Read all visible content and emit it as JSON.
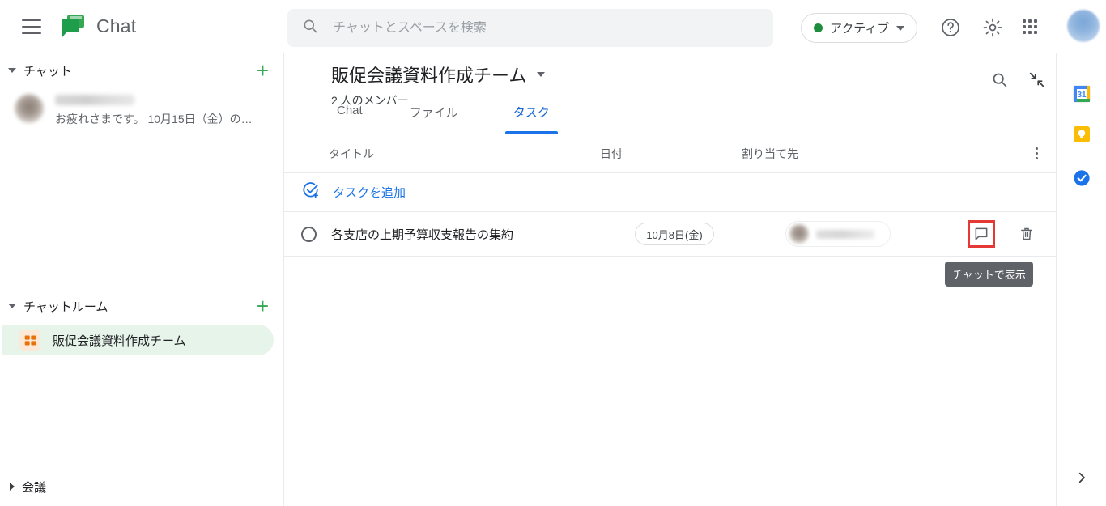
{
  "topbar": {
    "menu_icon": "hamburger-icon",
    "app_name": "Chat",
    "app_logo_icon": "google-chat-logo",
    "search": {
      "placeholder": "チャットとスペースを検索",
      "value": "",
      "icon": "search-icon"
    },
    "status": {
      "label": "アクティブ",
      "dot_color": "#1e8e3e",
      "caret_icon": "chevron-down-icon"
    },
    "help_icon": "help-circle-icon",
    "settings_icon": "gear-icon",
    "apps_icon": "apps-grid-icon",
    "account_avatar": "avatar"
  },
  "sidebar": {
    "chat_section": {
      "title": "チャット",
      "expand_icon": "triangle-down-icon",
      "add_icon": "plus-icon",
      "items": [
        {
          "name_redacted": true,
          "preview": "お疲れさまです。 10月15日（金）の…",
          "avatar": "avatar"
        }
      ]
    },
    "rooms_section": {
      "title": "チャットルーム",
      "expand_icon": "triangle-down-icon",
      "add_icon": "plus-icon",
      "items": [
        {
          "label": "販促会議資料作成チーム",
          "icon": "room-people-icon",
          "selected": true,
          "icon_bg": "#fce8d6",
          "selected_bg": "#e6f4ea"
        }
      ]
    },
    "meetings_section": {
      "title": "会議",
      "expand_icon": "triangle-right-icon"
    }
  },
  "main": {
    "room_title": "販促会議資料作成チーム",
    "room_title_caret": "chevron-down-icon",
    "member_count": "2 人のメンバー",
    "header_search_icon": "search-icon",
    "header_collapse_icon": "collapse-arrows-icon",
    "tabs": [
      {
        "label": "Chat",
        "active": false
      },
      {
        "label": "ファイル",
        "active": false
      },
      {
        "label": "タスク",
        "active": true
      }
    ],
    "active_tab_color": "#1a73e8",
    "columns": {
      "title": "タイトル",
      "date": "日付",
      "assignee": "割り当て先",
      "overflow_icon": "more-vertical-icon"
    },
    "add_task": {
      "label": "タスクを追加",
      "icon": "add-task-icon",
      "color": "#1a73e8"
    },
    "tasks": [
      {
        "checkbox_icon": "circle-checkbox-icon",
        "title": "各支店の上期予算収支報告の集約",
        "date": "10月8日(金)",
        "assignee_redacted": true,
        "chat_action_icon": "chat-bubble-icon",
        "delete_action_icon": "trash-icon",
        "chat_action_highlighted": true,
        "highlight_color": "#e53935"
      }
    ],
    "tooltip": "チャットで表示"
  },
  "right_rail": {
    "items": [
      {
        "icon": "google-calendar-icon",
        "day": "31"
      },
      {
        "icon": "google-keep-icon"
      },
      {
        "icon": "google-tasks-icon"
      }
    ],
    "expand_icon": "chevron-right-icon"
  }
}
